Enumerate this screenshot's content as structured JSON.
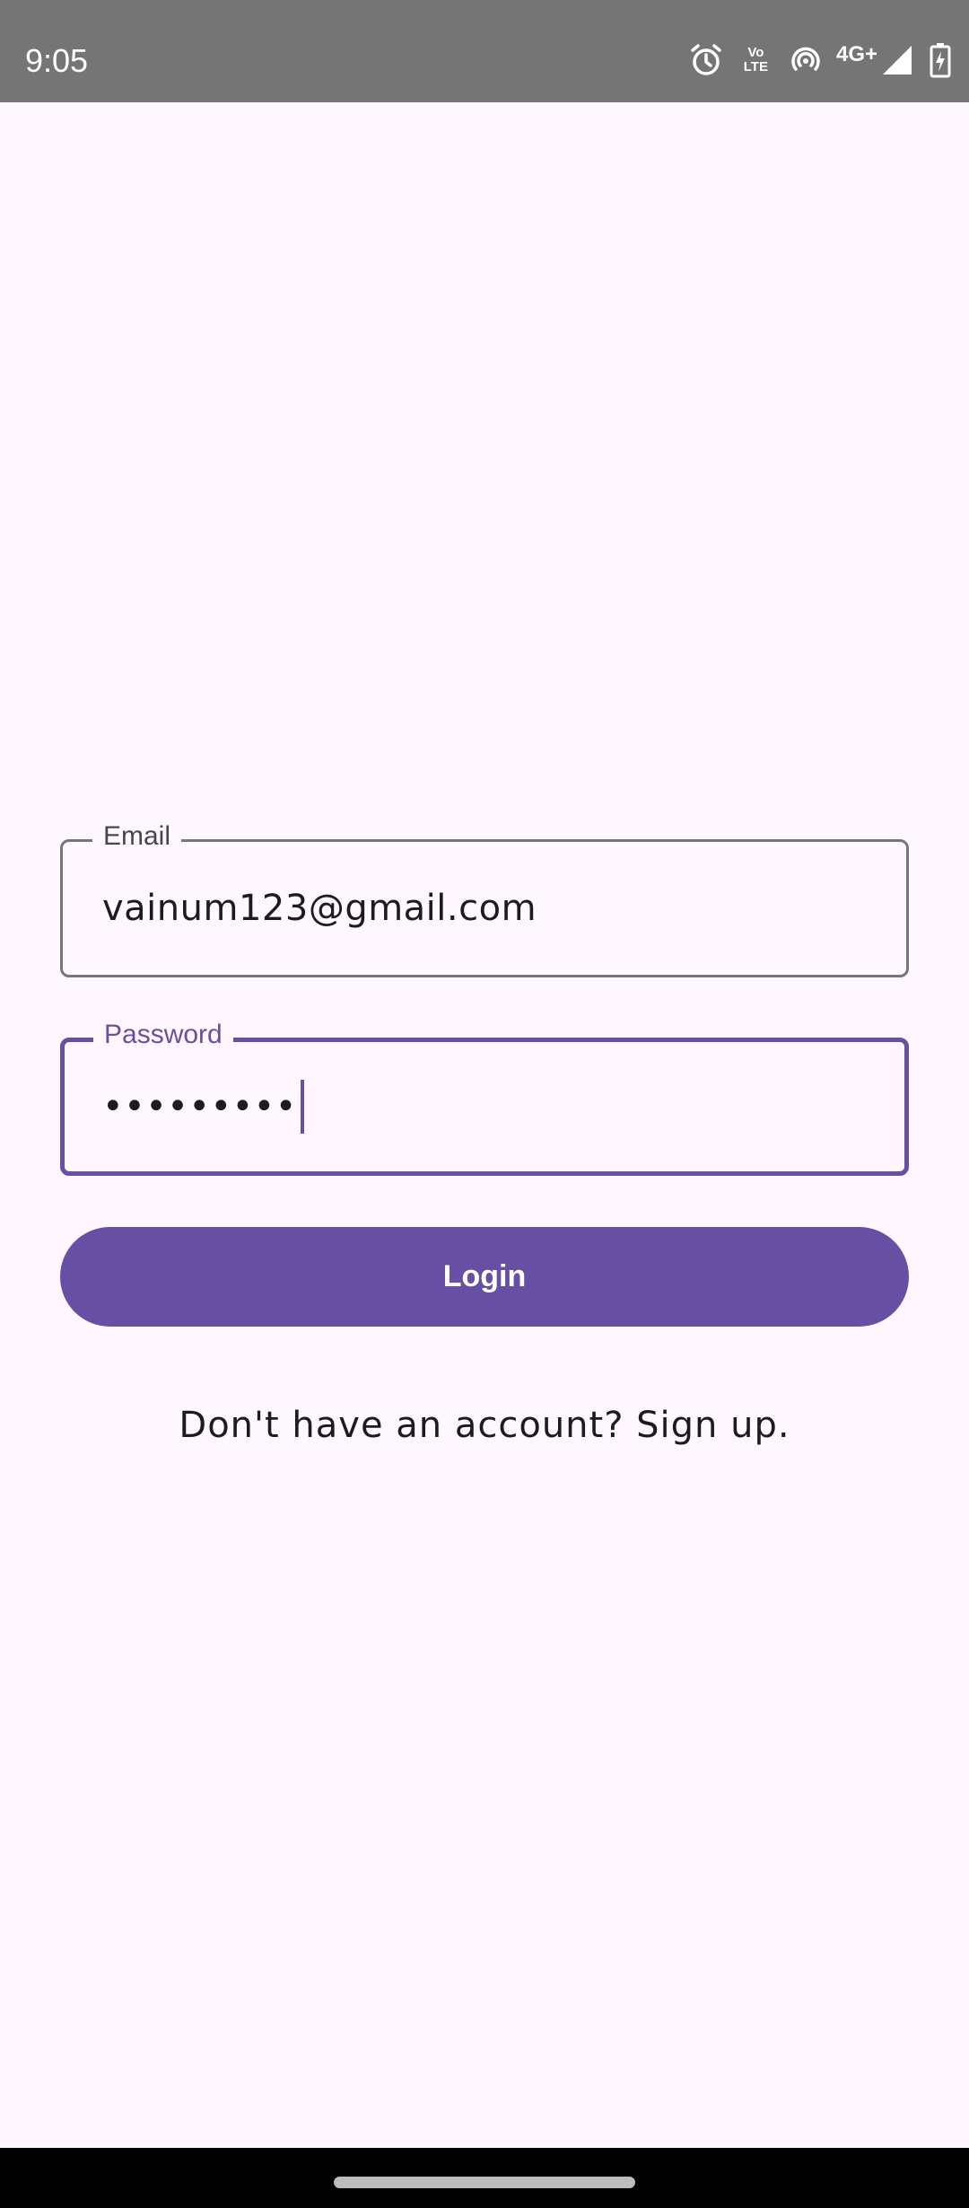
{
  "status_bar": {
    "time": "9:05",
    "icons": [
      "alarm-icon",
      "volte-icon",
      "hotspot-icon",
      "4g-plus-icon",
      "signal-icon",
      "battery-charging-icon"
    ],
    "volte_top": "Vo",
    "volte_bottom": "LTE",
    "network": "4G+"
  },
  "login_form": {
    "email_label": "Email",
    "email_value": "vainum123@gmail.com",
    "password_label": "Password",
    "password_value": "•••••••••",
    "login_label": "Login",
    "signup_text": "Don't have an account? Sign up."
  },
  "colors": {
    "primary": "#6750A4",
    "background": "#FEF7FF",
    "outline": "#79747E",
    "status_bar": "#757575"
  }
}
